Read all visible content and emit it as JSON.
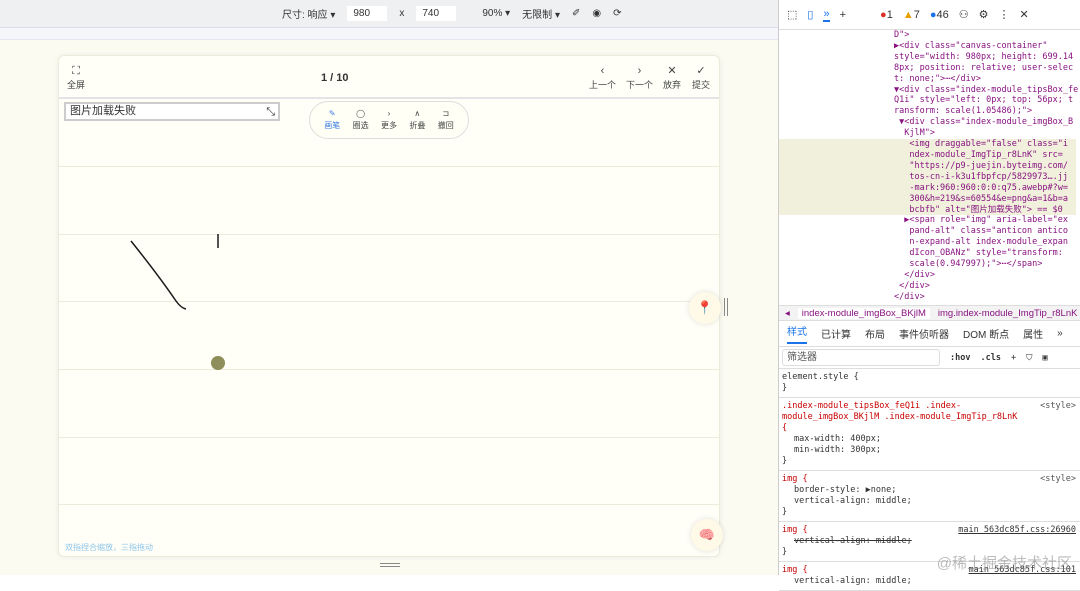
{
  "toolbar": {
    "size_label": "尺寸: 响应 ▾",
    "width": "980",
    "times": "x",
    "height": "740",
    "zoom": "90% ▾",
    "throttle": "无限制 ▾"
  },
  "card": {
    "fullscreen": "全屏",
    "pager": "1 / 10",
    "prev": "上一个",
    "next": "下一个",
    "discard": "放弃",
    "submit": "提交",
    "img_alt": "图片加载失败",
    "tools": [
      {
        "icon": "✎",
        "label": "画笔"
      },
      {
        "icon": "◯",
        "label": "圈选"
      },
      {
        "icon": "›",
        "label": "更多"
      },
      {
        "icon": "∧",
        "label": "折叠"
      },
      {
        "icon": "⊐",
        "label": "撤回"
      }
    ],
    "hint": "双指捏合缩放，三指拖动"
  },
  "stroke_color": "#1a1a1a",
  "dot_color": "#8e8e5a",
  "devtools": {
    "errors": "1",
    "warnings": "7",
    "info": "46",
    "dom_lines": [
      "D\">",
      "▶<div class=\"canvas-container\"",
      "style=\"width: 980px; height: 699.14",
      "8px; position: relative; user-selec",
      "t: none;\">⋯</div>",
      "▼<div class=\"index-module_tipsBox_fe",
      "Q1i\" style=\"left: 0px; top: 56px; t",
      "ransform: scale(1.05486);\">",
      " ▼<div class=\"index-module_imgBox_B",
      "  KjlM\">",
      "   <img draggable=\"false\" class=\"i",
      "   ndex-module_ImgTip_r8LnK\" src=",
      "   \"https://p9-juejin.byteimg.com/",
      "   tos-cn-i-k3u1fbpfcp/5829973….jj",
      "   -mark:960:960:0:0:q75.awebp#?w=",
      "   300&h=219&s=60554&e=png&a=1&b=a",
      "   bcbfb\" alt=\"图片加载失败\"> == $0",
      "  ▶<span role=\"img\" aria-label=\"ex",
      "   pand-alt\" class=\"anticon antico",
      "   n-expand-alt index-module_expan",
      "   dIcon_OBANz\" style=\"transform:",
      "   scale(0.947997);\">⋯</span>",
      "  </div>",
      " </div>",
      "</div>"
    ],
    "crumbs": [
      "index-module_imgBox_BKjlM",
      "img.index-module_ImgTip_r8LnK"
    ],
    "tabs": [
      "样式",
      "已计算",
      "布局",
      "事件侦听器",
      "DOM 断点",
      "属性"
    ],
    "filter_placeholder": "筛选器",
    "hov": ":hov",
    "cls": ".cls",
    "rules": [
      {
        "sel": "element.style {",
        "props": [],
        "src": ""
      },
      {
        "sel": ".index-module_tipsBox_feQ1i .index-module_imgBox_BKjlM .index-module_ImgTip_r8LnK {",
        "props": [
          "max-width: 400px;",
          "min-width: 300px;"
        ],
        "src": "<style>"
      },
      {
        "sel": "img {",
        "props": [
          "border-style: ▶none;",
          "vertical-align: middle;"
        ],
        "src": "<style>"
      },
      {
        "sel": "img {",
        "props": [
          "vertical-align: middle;"
        ],
        "src": "main_563dc85f.css:26960"
      },
      {
        "sel": "img {",
        "props": [
          "vertical-align: middle;"
        ],
        "src": "main_563dc85f.css:101"
      }
    ],
    "watermark": "@稀土掘金技术社区"
  }
}
